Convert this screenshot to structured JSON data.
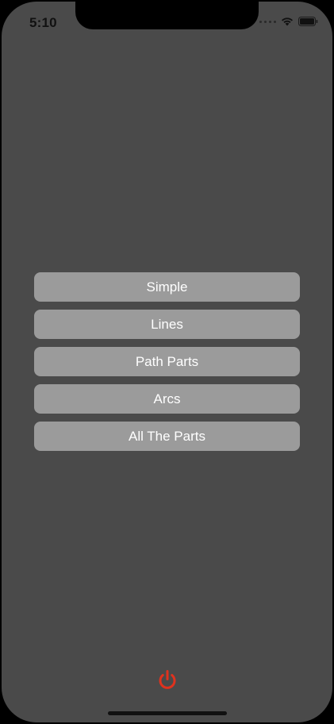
{
  "status_bar": {
    "time": "5:10"
  },
  "icons": {
    "wifi": "wifi-icon",
    "battery": "battery-icon",
    "power": "power-icon"
  },
  "colors": {
    "background": "#4a4a4a",
    "button": "#9b9b9b",
    "button_text": "#ffffff",
    "power_icon": "#e0321e"
  },
  "menu": {
    "items": [
      {
        "label": "Simple"
      },
      {
        "label": "Lines"
      },
      {
        "label": "Path Parts"
      },
      {
        "label": "Arcs"
      },
      {
        "label": "All The Parts"
      }
    ]
  }
}
